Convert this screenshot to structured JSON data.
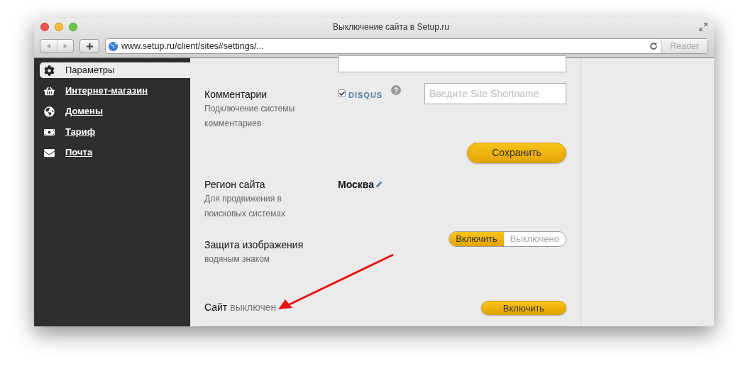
{
  "window": {
    "title": "Выключение сайта в Setup.ru"
  },
  "toolbar": {
    "url": "www.setup.ru/client/sites#settings/...",
    "reader": "Reader"
  },
  "sidebar": {
    "items": [
      {
        "label": "Параметры",
        "selected": true
      },
      {
        "label": "Интернет-магазин",
        "selected": false
      },
      {
        "label": "Домены",
        "selected": false
      },
      {
        "label": "Тариф",
        "selected": false
      },
      {
        "label": "Почта",
        "selected": false
      }
    ]
  },
  "settings": {
    "comments": {
      "title": "Комментарии",
      "description": "Подключение системы комментариев",
      "checked": true,
      "service": "DISQUS",
      "placeholder": "Введите Site Shortname",
      "save": "Сохранить"
    },
    "region": {
      "title": "Регион сайта",
      "description": "Для продвижения в поисковых системах",
      "value": "Москва"
    },
    "watermark": {
      "title": "Защита изображения",
      "description": "водяным знаком",
      "options": [
        {
          "label": "Включить",
          "selected": true
        },
        {
          "label": "Выключено",
          "selected": false
        }
      ]
    },
    "site_status": {
      "label": "Сайт",
      "state": "выключен",
      "button": "Включить"
    }
  }
}
